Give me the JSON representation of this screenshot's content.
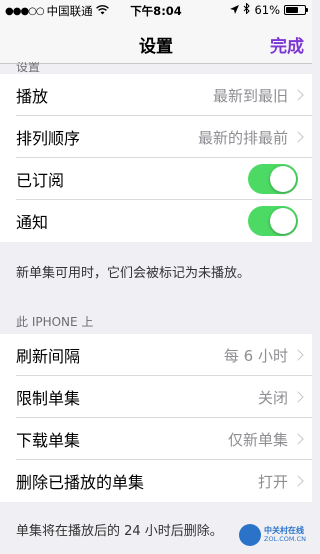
{
  "status_bar": {
    "carrier": "中国联通",
    "time": "下午8:04",
    "battery": "61%"
  },
  "nav": {
    "title": "设置",
    "done": "完成"
  },
  "partial_header": "设置",
  "group1": {
    "rows": [
      {
        "label": "播放",
        "value": "最新到最旧"
      },
      {
        "label": "排列顺序",
        "value": "最新的排最前"
      },
      {
        "label": "已订阅",
        "toggle": true
      },
      {
        "label": "通知",
        "toggle": true
      }
    ],
    "footer": "新单集可用时，它们会被标记为未播放。"
  },
  "group2": {
    "header": "此 IPHONE 上",
    "rows": [
      {
        "label": "刷新间隔",
        "value": "每 6 小时"
      },
      {
        "label": "限制单集",
        "value": "关闭"
      },
      {
        "label": "下载单集",
        "value": "仅新单集"
      },
      {
        "label": "删除已播放的单集",
        "value": "打开"
      }
    ],
    "footer": "单集将在播放后的 24 小时后删除。"
  },
  "watermark": {
    "name": "中关村在线",
    "url": "ZOL.COM.CN"
  },
  "colors": {
    "accent": "#7d36d6",
    "toggle_on": "#4cd964"
  }
}
